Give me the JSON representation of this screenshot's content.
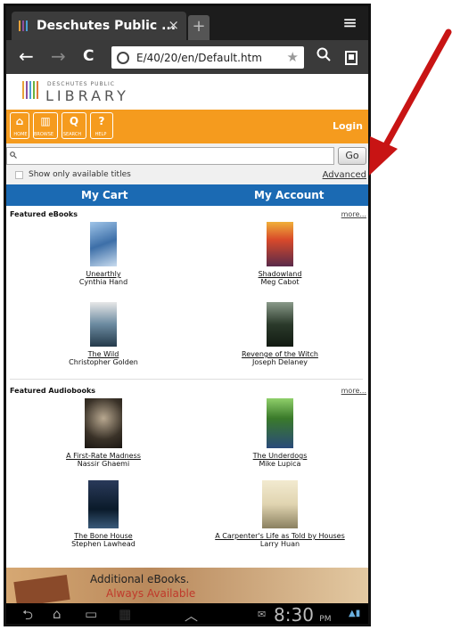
{
  "browser": {
    "tab_title": "Deschutes Public ...",
    "tab_close": "×",
    "new_tab": "+",
    "menu": "≡",
    "back": "←",
    "forward": "→",
    "reload": "C",
    "url": "E/40/20/en/Default.htm",
    "search_glyph": "🔍",
    "bookmark_glyph": "★"
  },
  "library": {
    "logo_small": "DESCHUTES PUBLIC",
    "logo_big": "LIBRARY"
  },
  "toolbar": {
    "home": "HOME",
    "browse": "BROWSE",
    "search": "SEARCH",
    "help": "HELP",
    "login": "Login"
  },
  "search": {
    "go_label": "Go",
    "available_label": "Show only available titles",
    "advanced_label": "Advanced"
  },
  "bluebar": {
    "cart": "My Cart",
    "account": "My Account"
  },
  "ebooks": {
    "title": "Featured eBooks",
    "more": "more...",
    "items": [
      {
        "title": "Unearthly",
        "author": "Cynthia Hand"
      },
      {
        "title": "Shadowland",
        "author": "Meg Cabot"
      },
      {
        "title": "The Wild",
        "author": "Christopher Golden"
      },
      {
        "title": "Revenge of the Witch",
        "author": "Joseph Delaney"
      }
    ]
  },
  "audiobooks": {
    "title": "Featured Audiobooks",
    "more": "more...",
    "items": [
      {
        "title": "A First-Rate Madness",
        "author": "Nassir Ghaemi"
      },
      {
        "title": "The Underdogs",
        "author": "Mike Lupica"
      },
      {
        "title": "The Bone House",
        "author": "Stephen Lawhead"
      },
      {
        "title": "A Carpenter's Life as Told by Houses",
        "author": "Larry Huan"
      }
    ]
  },
  "ad": {
    "line1": "Additional eBooks.",
    "line2": "Always Available"
  },
  "status": {
    "time": "8:30",
    "ampm": "PM"
  },
  "colors": {
    "toolbar": "#f59b1e",
    "bluebar": "#1b6ab3",
    "arrow": "#c81414"
  }
}
